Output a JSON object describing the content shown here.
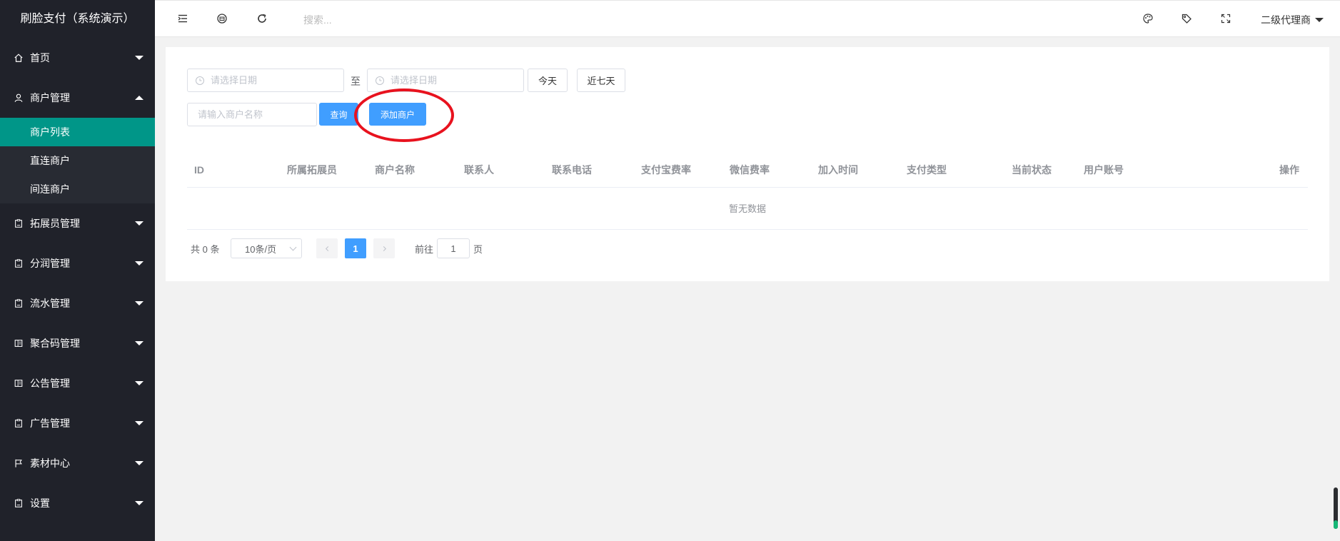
{
  "app": {
    "title": "刷脸支付（系统演示）"
  },
  "sidebar": {
    "items": [
      {
        "label": "首页",
        "icon": "home-icon",
        "expanded": false
      },
      {
        "label": "商户管理",
        "icon": "user-icon",
        "expanded": true,
        "children": [
          {
            "label": "商户列表",
            "active": true
          },
          {
            "label": "直连商户",
            "active": false
          },
          {
            "label": "间连商户",
            "active": false
          }
        ]
      },
      {
        "label": "拓展员管理",
        "icon": "clipboard-icon",
        "expanded": false
      },
      {
        "label": "分润管理",
        "icon": "clipboard-icon",
        "expanded": false
      },
      {
        "label": "流水管理",
        "icon": "clipboard-icon",
        "expanded": false
      },
      {
        "label": "聚合码管理",
        "icon": "template-icon",
        "expanded": false
      },
      {
        "label": "公告管理",
        "icon": "template-icon",
        "expanded": false
      },
      {
        "label": "广告管理",
        "icon": "clipboard-icon",
        "expanded": false
      },
      {
        "label": "素材中心",
        "icon": "flag-icon",
        "expanded": false
      },
      {
        "label": "设置",
        "icon": "clipboard-icon",
        "expanded": false
      }
    ]
  },
  "header": {
    "search_placeholder": "搜索...",
    "user_label": "二级代理商",
    "icons": [
      "menu-toggle-icon",
      "website-icon",
      "refresh-icon",
      "theme-palette-icon",
      "tag-icon",
      "fullscreen-icon"
    ]
  },
  "filters": {
    "start_date_placeholder": "请选择日期",
    "to_label": "至",
    "end_date_placeholder": "请选择日期",
    "today_label": "今天",
    "last7_label": "近七天",
    "merchant_placeholder": "请输入商户名称",
    "query_label": "查询",
    "add_label": "添加商户"
  },
  "table": {
    "columns": [
      "ID",
      "所属拓展员",
      "商户名称",
      "联系人",
      "联系电话",
      "支付宝费率",
      "微信费率",
      "加入时间",
      "支付类型",
      "当前状态",
      "用户账号",
      "操作"
    ],
    "empty_text": "暂无数据"
  },
  "pagination": {
    "total_text": "共 0 条",
    "page_size": "10条/页",
    "current_page": "1",
    "goto_prefix": "前往",
    "goto_value": "1",
    "goto_suffix": "页"
  },
  "colors": {
    "sidebar_bg": "#20222a",
    "active_item": "#009688",
    "primary": "#409eff",
    "highlight_ring": "#e8121e"
  }
}
